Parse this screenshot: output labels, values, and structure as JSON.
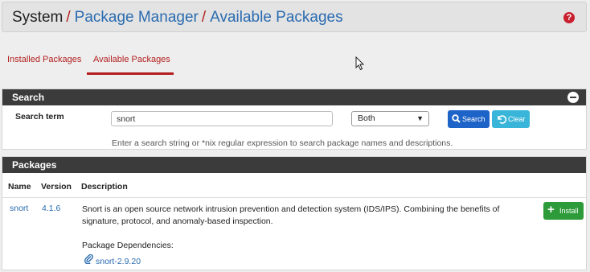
{
  "breadcrumb": {
    "root": "System",
    "separator": "/",
    "items": [
      "Package Manager",
      "Available Packages"
    ]
  },
  "help_icon": "?",
  "tabs": [
    {
      "label": "Installed Packages",
      "active": false
    },
    {
      "label": "Available Packages",
      "active": true
    }
  ],
  "search_panel": {
    "title": "Search",
    "term_label": "Search term",
    "term_value": "snort",
    "scope_value": "Both",
    "search_button": "Search",
    "clear_button": "Clear",
    "hint": "Enter a search string or *nix regular expression to search package names and descriptions."
  },
  "packages_panel": {
    "title": "Packages",
    "columns": [
      "Name",
      "Version",
      "Description"
    ],
    "rows": [
      {
        "name": "snort",
        "version": "4.1.6",
        "description": "Snort is an open source network intrusion prevention and detection system (IDS/IPS). Combining the benefits of signature, protocol, and anomaly-based inspection.",
        "deps_label": "Package Dependencies:",
        "dependency": "snort-2.9.20",
        "install_button": "Install"
      }
    ]
  },
  "colors": {
    "accent_red": "#b31f1f",
    "link_blue": "#2a6bb0",
    "panel_header": "#3b3b3b",
    "search_btn": "#1e64c8",
    "clear_btn": "#38b5d8",
    "install_btn": "#2d9b3a"
  },
  "icons": {
    "search": "magnifier-icon",
    "clear": "undo-icon",
    "install": "plus-icon",
    "dependency": "paperclip-icon",
    "collapse": "minus-circle-icon",
    "help": "question-circle-icon"
  }
}
